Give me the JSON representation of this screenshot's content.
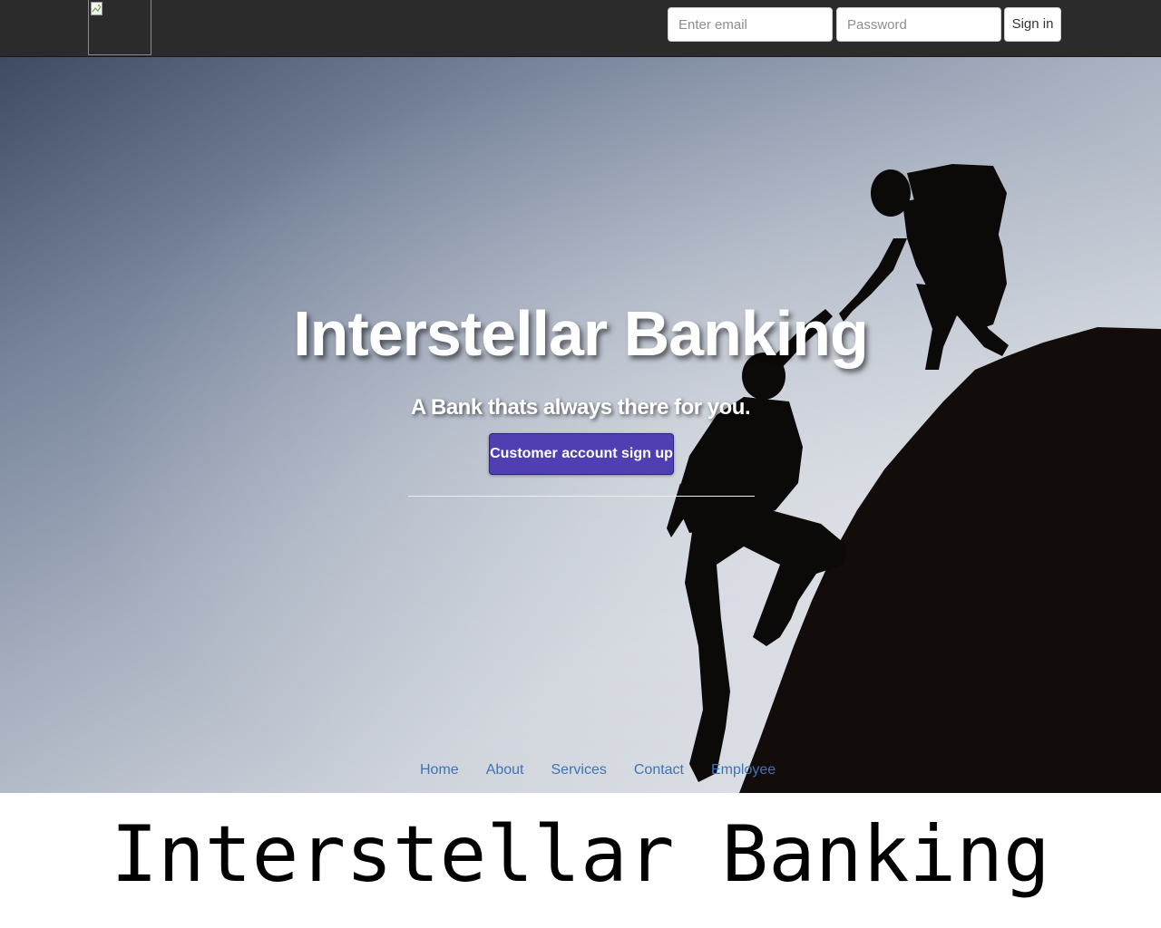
{
  "navbar": {
    "email_placeholder": "Enter email",
    "password_placeholder": "Password",
    "signin_label": "Sign in"
  },
  "hero": {
    "title": "Interstellar Banking",
    "subtitle": "A Bank thats always there for you.",
    "cta_label": "Customer account sign up"
  },
  "footer_nav": [
    {
      "label": "Home"
    },
    {
      "label": "About"
    },
    {
      "label": "Services"
    },
    {
      "label": "Contact"
    },
    {
      "label": "Employee"
    }
  ],
  "caption": "Interstellar Banking",
  "colors": {
    "navbar_bg": "#2b2b2b",
    "cta_bg": "#4f3fb3",
    "link": "#3f73b8"
  }
}
